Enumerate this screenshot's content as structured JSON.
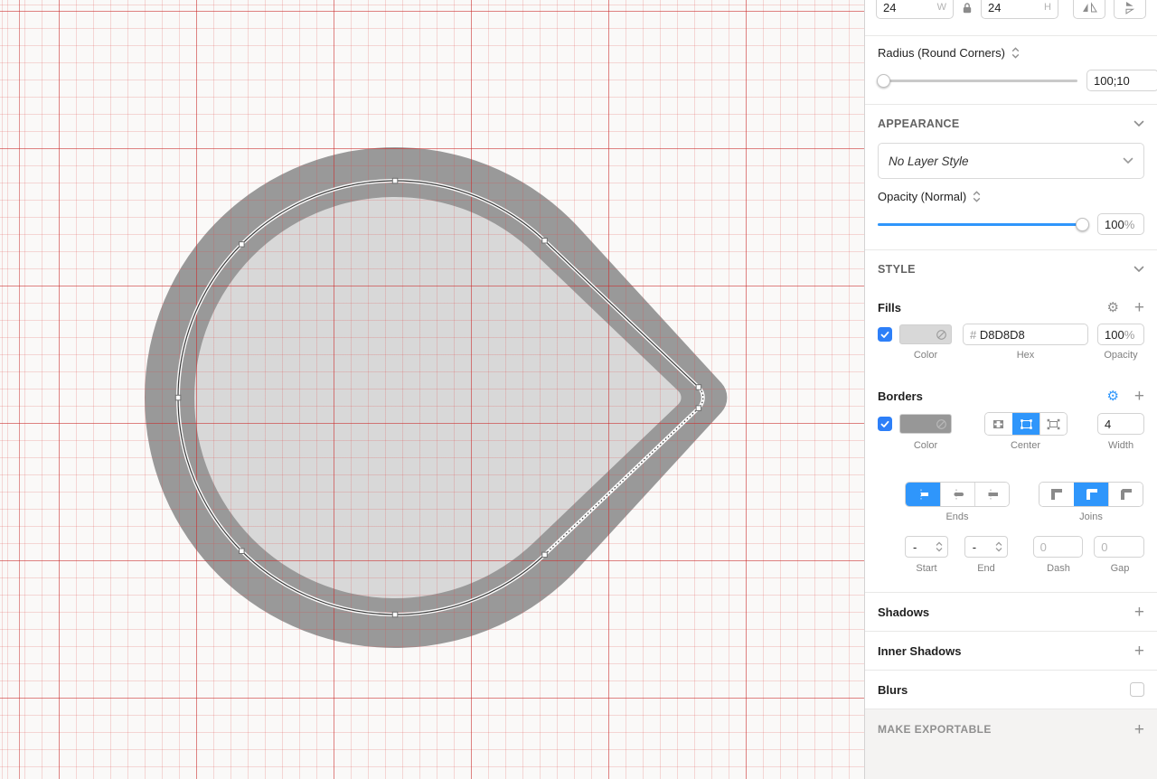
{
  "canvas": {
    "shape": {
      "fill_color": "#D8D8D8",
      "border_color": "#999999"
    }
  },
  "inspector": {
    "icons": {
      "add": "+",
      "gear": "⚙"
    },
    "size": {
      "width": "24",
      "width_unit": "W",
      "height": "24",
      "height_unit": "H"
    },
    "radius": {
      "label": "Radius (Round Corners)",
      "value": "100;10"
    },
    "appearance": {
      "header": "APPEARANCE",
      "layer_style": "No Layer Style"
    },
    "opacity": {
      "label": "Opacity (Normal)",
      "value": "100",
      "unit": "%"
    },
    "style": {
      "header": "STYLE"
    },
    "fills": {
      "title": "Fills",
      "hex_prefix": "#",
      "hex": "D8D8D8",
      "opacity": "100",
      "opacity_unit": "%",
      "color_label": "Color",
      "hex_label": "Hex",
      "opacity_label": "Opacity"
    },
    "borders": {
      "title": "Borders",
      "width": "4",
      "color_label": "Color",
      "position_label": "Center",
      "width_label": "Width"
    },
    "stroke_options": {
      "ends_label": "Ends",
      "joins_label": "Joins",
      "start_value": "-",
      "end_value": "-",
      "dash_value": "0",
      "gap_value": "0",
      "start_label": "Start",
      "end_label": "End",
      "dash_label": "Dash",
      "gap_label": "Gap"
    },
    "shadows": {
      "title": "Shadows"
    },
    "inner_shadows": {
      "title": "Inner Shadows"
    },
    "blurs": {
      "title": "Blurs"
    },
    "make_exportable": {
      "title": "MAKE EXPORTABLE"
    }
  }
}
